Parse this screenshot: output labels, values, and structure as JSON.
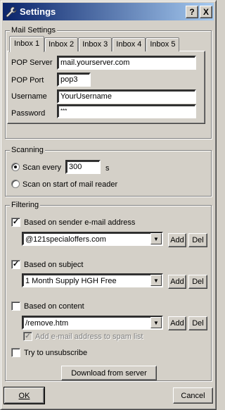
{
  "window": {
    "title": "Settings",
    "help": "?",
    "close": "X"
  },
  "mail_settings": {
    "group_label": "Mail Settings",
    "tabs": [
      "Inbox 1",
      "Inbox 2",
      "Inbox 3",
      "Inbox 4",
      "Inbox 5"
    ],
    "active_tab": "Inbox 1",
    "pop_server_label": "POP Server",
    "pop_server_value": "mail.yourserver.com",
    "pop_port_label": "POP Port",
    "pop_port_value": "pop3",
    "username_label": "Username",
    "username_value": "YourUsername",
    "password_label": "Password",
    "password_value": "***"
  },
  "scanning": {
    "group_label": "Scanning",
    "scan_every_label": "Scan every",
    "scan_every_value": "300",
    "scan_every_unit": "s",
    "scan_on_start_label": "Scan on start of mail reader",
    "selected": "scan_every"
  },
  "filtering": {
    "group_label": "Filtering",
    "sender": {
      "label": "Based on sender e-mail address",
      "checked": true,
      "value": "@121specialoffers.com"
    },
    "subject": {
      "label": "Based on subject",
      "checked": true,
      "value": "1 Month Supply HGH Free"
    },
    "content": {
      "label": "Based on content",
      "checked": false,
      "value": "/remove.htm"
    },
    "add_to_spam_label": "Add e-mail address to spam list",
    "unsubscribe_label": "Try to unsubscribe",
    "add_label": "Add",
    "del_label": "Del",
    "download_label": "Download from server"
  },
  "footer": {
    "ok": "OK",
    "cancel": "Cancel"
  },
  "icons": {
    "app": "wrench-icon",
    "check": "✓",
    "dropdown": "▼"
  }
}
